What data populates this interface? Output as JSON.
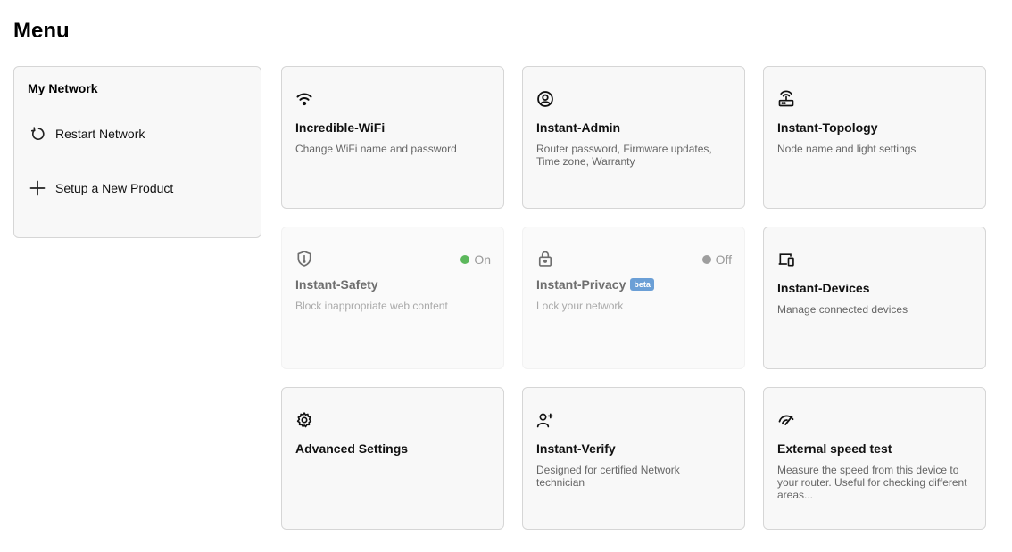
{
  "page": {
    "title": "Menu"
  },
  "sidebar": {
    "title": "My Network",
    "actions": [
      {
        "label": "Restart Network",
        "icon": "restart-icon"
      },
      {
        "label": "Setup a New Product",
        "icon": "plus-icon"
      }
    ]
  },
  "cards": [
    {
      "title": "Incredible-WiFi",
      "description": "Change WiFi name and password",
      "icon": "wifi-icon"
    },
    {
      "title": "Instant-Admin",
      "description": "Router password, Firmware updates, Time zone, Warranty",
      "icon": "user-circle-icon"
    },
    {
      "title": "Instant-Topology",
      "description": "Node name and light settings",
      "icon": "router-icon"
    },
    {
      "title": "Instant-Safety",
      "description": "Block inappropriate web content",
      "icon": "shield-icon",
      "status": "On",
      "status_color": "#5cb85c"
    },
    {
      "title": "Instant-Privacy",
      "badge": "beta",
      "description": "Lock your network",
      "icon": "lock-icon",
      "status": "Off",
      "status_color": "#9e9e9e"
    },
    {
      "title": "Instant-Devices",
      "description": "Manage connected devices",
      "icon": "devices-icon"
    },
    {
      "title": "Advanced Settings",
      "description": "",
      "icon": "gear-icon"
    },
    {
      "title": "Instant-Verify",
      "description": "Designed for certified Network technician",
      "icon": "technician-icon"
    },
    {
      "title": "External speed test",
      "description": "Measure the speed from this device to your router. Useful for checking different areas...",
      "icon": "speedometer-icon"
    }
  ]
}
